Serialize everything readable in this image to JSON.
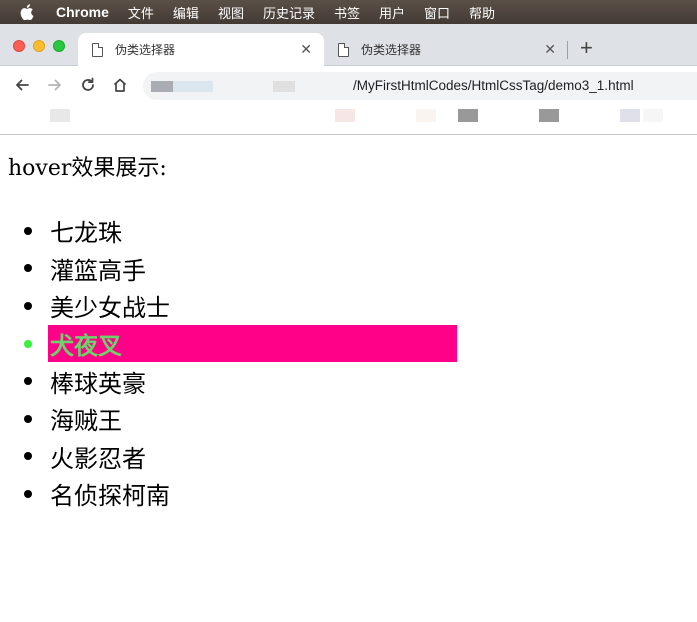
{
  "menubar": {
    "app_name": "Chrome",
    "items": [
      "文件",
      "编辑",
      "视图",
      "历史记录",
      "书签",
      "用户",
      "窗口",
      "帮助"
    ]
  },
  "tabs": [
    {
      "title": "伪类选择器",
      "close": "✕",
      "active": true
    },
    {
      "title": "伪类选择器",
      "close": "✕",
      "active": false
    }
  ],
  "new_tab_label": "+",
  "toolbar": {
    "url": "/MyFirstHtmlCodes/HtmlCssTag/demo3_1.html"
  },
  "page": {
    "heading": "hover效果展示:",
    "items": [
      "七龙珠",
      "灌篮高手",
      "美少女战士",
      "犬夜叉",
      "棒球英豪",
      "海贼王",
      "火影忍者",
      "名侦探柯南"
    ],
    "hovered_index": 3
  },
  "colors": {
    "hover_background": "#ff0088",
    "hover_text": "#6bd36a",
    "hover_bullet": "#39f03a",
    "menubar": "#4a4039",
    "tabstrip": "#dee1e6"
  }
}
